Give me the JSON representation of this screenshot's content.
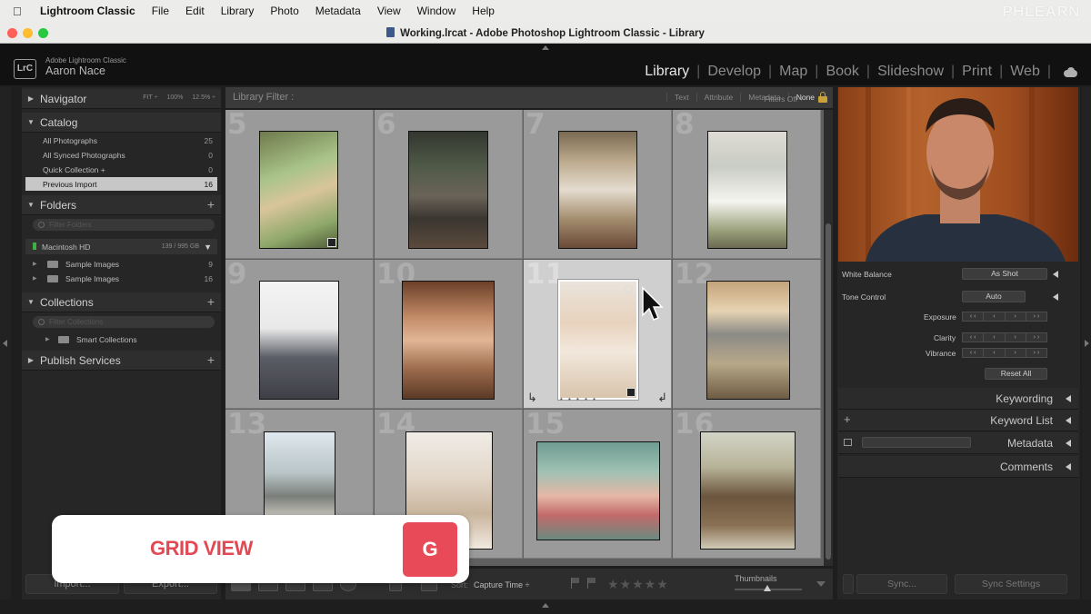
{
  "menubar": {
    "app_name": "Lightroom Classic",
    "items": [
      "File",
      "Edit",
      "Library",
      "Photo",
      "Metadata",
      "View",
      "Window",
      "Help"
    ],
    "watermark": "PHLEARN"
  },
  "window": {
    "title": "Working.lrcat - Adobe Photoshop Lightroom Classic - Library"
  },
  "identity": {
    "badge": "LrC",
    "product": "Adobe Lightroom Classic",
    "user": "Aaron Nace"
  },
  "modules": {
    "items": [
      "Library",
      "Develop",
      "Map",
      "Book",
      "Slideshow",
      "Print",
      "Web"
    ],
    "active": "Library"
  },
  "left": {
    "navigator": {
      "title": "Navigator",
      "options": [
        "FIT ÷",
        "100%",
        "12.5% ÷"
      ]
    },
    "catalog": {
      "title": "Catalog",
      "rows": [
        {
          "label": "All Photographs",
          "count": "25"
        },
        {
          "label": "All Synced Photographs",
          "count": "0"
        },
        {
          "label": "Quick Collection +",
          "count": "0"
        },
        {
          "label": "Previous Import",
          "count": "16"
        }
      ]
    },
    "folders": {
      "title": "Folders",
      "filter_placeholder": "Filter Folders",
      "volume": {
        "name": "Macintosh HD",
        "size": "139 / 995 GB"
      },
      "rows": [
        {
          "label": "Sample Images",
          "count": "9"
        },
        {
          "label": "Sample Images",
          "count": "16"
        }
      ]
    },
    "collections": {
      "title": "Collections",
      "filter_placeholder": "Filter Collections",
      "rows": [
        {
          "label": "Smart Collections"
        }
      ]
    },
    "publish": {
      "title": "Publish Services"
    },
    "import_label": "Import...",
    "export_label": "Export..."
  },
  "filterbar": {
    "label": "Library Filter :",
    "tabs": [
      "Text",
      "Attribute",
      "Metadata",
      "None"
    ],
    "active_tab": "None",
    "filters_off": "Filters Off ÷"
  },
  "grid": {
    "cells": [
      {
        "num": "5"
      },
      {
        "num": "6"
      },
      {
        "num": "7"
      },
      {
        "num": "8"
      },
      {
        "num": "9"
      },
      {
        "num": "10"
      },
      {
        "num": "11"
      },
      {
        "num": "12"
      },
      {
        "num": "13"
      },
      {
        "num": "14"
      },
      {
        "num": "15"
      },
      {
        "num": "16"
      }
    ],
    "selected": "11"
  },
  "toolbar": {
    "sort_label": "Sort:",
    "sort_value": "Capture Time ÷",
    "stars": "★★★★★",
    "thumbnails_label": "Thumbnails"
  },
  "overlay": {
    "text": "GRID VIEW",
    "key": "G"
  },
  "right": {
    "white_balance": {
      "label": "White Balance",
      "value": "As Shot"
    },
    "tone_control": {
      "label": "Tone Control",
      "auto": "Auto"
    },
    "sliders": [
      {
        "label": "Exposure"
      },
      {
        "label": "Clarity"
      },
      {
        "label": "Vibrance"
      }
    ],
    "reset_all": "Reset All",
    "panels": [
      "Keywording",
      "Keyword List",
      "Metadata",
      "Comments"
    ],
    "sync_label": "Sync...",
    "sync_settings_label": "Sync Settings"
  }
}
